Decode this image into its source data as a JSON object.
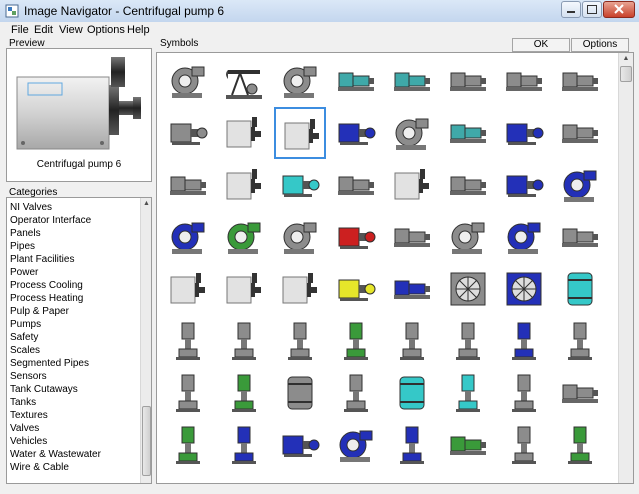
{
  "window": {
    "title": "Image Navigator - Centrifugal pump 6",
    "icon": "image-navigator-icon",
    "controls": [
      "minimize-icon",
      "maximize-icon",
      "close-icon"
    ]
  },
  "menu": [
    "File",
    "Edit",
    "View",
    "Options",
    "Help"
  ],
  "preview": {
    "label": "Preview",
    "caption": "Centrifugal pump 6"
  },
  "categories": {
    "label": "Categories",
    "items": [
      "NI Valves",
      "Operator Interface",
      "Panels",
      "Pipes",
      "Plant Facilities",
      "Power",
      "Process Cooling",
      "Process Heating",
      "Pulp & Paper",
      "Pumps",
      "Safety",
      "Scales",
      "Segmented Pipes",
      "Sensors",
      "Tank Cutaways",
      "Tanks",
      "Textures",
      "Valves",
      "Vehicles",
      "Water & Wastewater",
      "Wire & Cable"
    ],
    "selected": "Pumps"
  },
  "symbols": {
    "label": "Symbols",
    "ok_label": "OK",
    "options_label": "Options",
    "selected_index": 10,
    "colors": {
      "selection": "#3c8de0",
      "grey": "#8c8c8c",
      "teal": "#3fa9a9",
      "blue": "#2330b8",
      "green": "#3a9a3a",
      "red": "#cc2020",
      "yellow": "#e6e62a",
      "cyan": "#35c8c8"
    },
    "items": [
      {
        "name": "centrifugal-blower",
        "color": "grey",
        "shape": "blower"
      },
      {
        "name": "pump-jack",
        "color": "grey",
        "shape": "jack"
      },
      {
        "name": "positive-displacement-pump",
        "color": "grey",
        "shape": "blower"
      },
      {
        "name": "skid-pump-teal-1",
        "color": "teal",
        "shape": "skid"
      },
      {
        "name": "skid-pump-teal-2",
        "color": "teal",
        "shape": "skid"
      },
      {
        "name": "motor-pump-1",
        "color": "grey",
        "shape": "skid"
      },
      {
        "name": "motor-pump-2",
        "color": "grey",
        "shape": "skid"
      },
      {
        "name": "inline-pump-1",
        "color": "grey",
        "shape": "skid"
      },
      {
        "name": "centrifugal-pump-1",
        "color": "grey",
        "shape": "hpump"
      },
      {
        "name": "centrifugal-pump-5",
        "color": "grey",
        "shape": "box"
      },
      {
        "name": "centrifugal-pump-6",
        "color": "grey",
        "shape": "box"
      },
      {
        "name": "centrifugal-pump-blue",
        "color": "blue",
        "shape": "hpump"
      },
      {
        "name": "end-suction-pump",
        "color": "grey",
        "shape": "blower"
      },
      {
        "name": "pump-motor-teal",
        "color": "teal",
        "shape": "skid"
      },
      {
        "name": "pump-motor-blue",
        "color": "blue",
        "shape": "hpump"
      },
      {
        "name": "shaft-pump",
        "color": "grey",
        "shape": "skid"
      },
      {
        "name": "gear-pump",
        "color": "grey",
        "shape": "skid"
      },
      {
        "name": "framed-pump",
        "color": "grey",
        "shape": "box"
      },
      {
        "name": "cyan-pump",
        "color": "cyan",
        "shape": "hpump"
      },
      {
        "name": "motor-skid-pump",
        "color": "grey",
        "shape": "skid"
      },
      {
        "name": "cylinder-pump",
        "color": "grey",
        "shape": "box"
      },
      {
        "name": "base-pump",
        "color": "grey",
        "shape": "skid"
      },
      {
        "name": "small-blue-pump",
        "color": "blue",
        "shape": "hpump"
      },
      {
        "name": "volute-pump-blue",
        "color": "blue",
        "shape": "blower"
      },
      {
        "name": "blue-gear-pump",
        "color": "blue",
        "shape": "blower"
      },
      {
        "name": "green-pump",
        "color": "green",
        "shape": "blower"
      },
      {
        "name": "split-case-pump",
        "color": "grey",
        "shape": "blower"
      },
      {
        "name": "red-pump",
        "color": "red",
        "shape": "hpump"
      },
      {
        "name": "screw-pump",
        "color": "grey",
        "shape": "skid"
      },
      {
        "name": "grey-volute-pump",
        "color": "grey",
        "shape": "blower"
      },
      {
        "name": "purple-pump",
        "color": "blue",
        "shape": "blower"
      },
      {
        "name": "motor-grey",
        "color": "grey",
        "shape": "skid"
      },
      {
        "name": "tank-pump",
        "color": "grey",
        "shape": "box"
      },
      {
        "name": "cutaway-pump",
        "color": "grey",
        "shape": "box"
      },
      {
        "name": "column-pump",
        "color": "grey",
        "shape": "box"
      },
      {
        "name": "yellow-pump",
        "color": "yellow",
        "shape": "hpump"
      },
      {
        "name": "blue-skid-pump",
        "color": "blue",
        "shape": "skid"
      },
      {
        "name": "fan-housing",
        "color": "grey",
        "shape": "fan"
      },
      {
        "name": "blue-fan-housing",
        "color": "blue",
        "shape": "fan"
      },
      {
        "name": "cyan-tank",
        "color": "cyan",
        "shape": "tank"
      },
      {
        "name": "vertical-pump-1",
        "color": "grey",
        "shape": "vpump"
      },
      {
        "name": "vertical-pump-2",
        "color": "grey",
        "shape": "vpump"
      },
      {
        "name": "vertical-pump-3",
        "color": "grey",
        "shape": "vpump"
      },
      {
        "name": "vertical-pump-green",
        "color": "green",
        "shape": "vpump"
      },
      {
        "name": "vertical-pump-4",
        "color": "grey",
        "shape": "vpump"
      },
      {
        "name": "vertical-pump-5",
        "color": "grey",
        "shape": "vpump"
      },
      {
        "name": "vertical-pump-blue",
        "color": "blue",
        "shape": "vpump"
      },
      {
        "name": "vertical-pump-6",
        "color": "grey",
        "shape": "vpump"
      },
      {
        "name": "vertical-motor-pump",
        "color": "grey",
        "shape": "vpump"
      },
      {
        "name": "vertical-pump-green-2",
        "color": "green",
        "shape": "vpump"
      },
      {
        "name": "drum-pump",
        "color": "grey",
        "shape": "tank"
      },
      {
        "name": "vertical-pump-7",
        "color": "grey",
        "shape": "vpump"
      },
      {
        "name": "cyan-motor",
        "color": "cyan",
        "shape": "tank"
      },
      {
        "name": "cyan-vertical-pump",
        "color": "cyan",
        "shape": "vpump"
      },
      {
        "name": "small-vertical-pump",
        "color": "grey",
        "shape": "vpump"
      },
      {
        "name": "inline-motor-pump",
        "color": "grey",
        "shape": "skid"
      },
      {
        "name": "submersible-green",
        "color": "green",
        "shape": "vpump"
      },
      {
        "name": "submersible-blue-1",
        "color": "blue",
        "shape": "vpump"
      },
      {
        "name": "submersible-blue-2",
        "color": "blue",
        "shape": "hpump"
      },
      {
        "name": "submersible-blue-3",
        "color": "blue",
        "shape": "blower"
      },
      {
        "name": "submersible-blue-4",
        "color": "blue",
        "shape": "vpump"
      },
      {
        "name": "green-skid-pump",
        "color": "green",
        "shape": "skid"
      },
      {
        "name": "small-vertical-pump-2",
        "color": "grey",
        "shape": "vpump"
      },
      {
        "name": "green-motor-pump",
        "color": "green",
        "shape": "vpump"
      }
    ]
  }
}
